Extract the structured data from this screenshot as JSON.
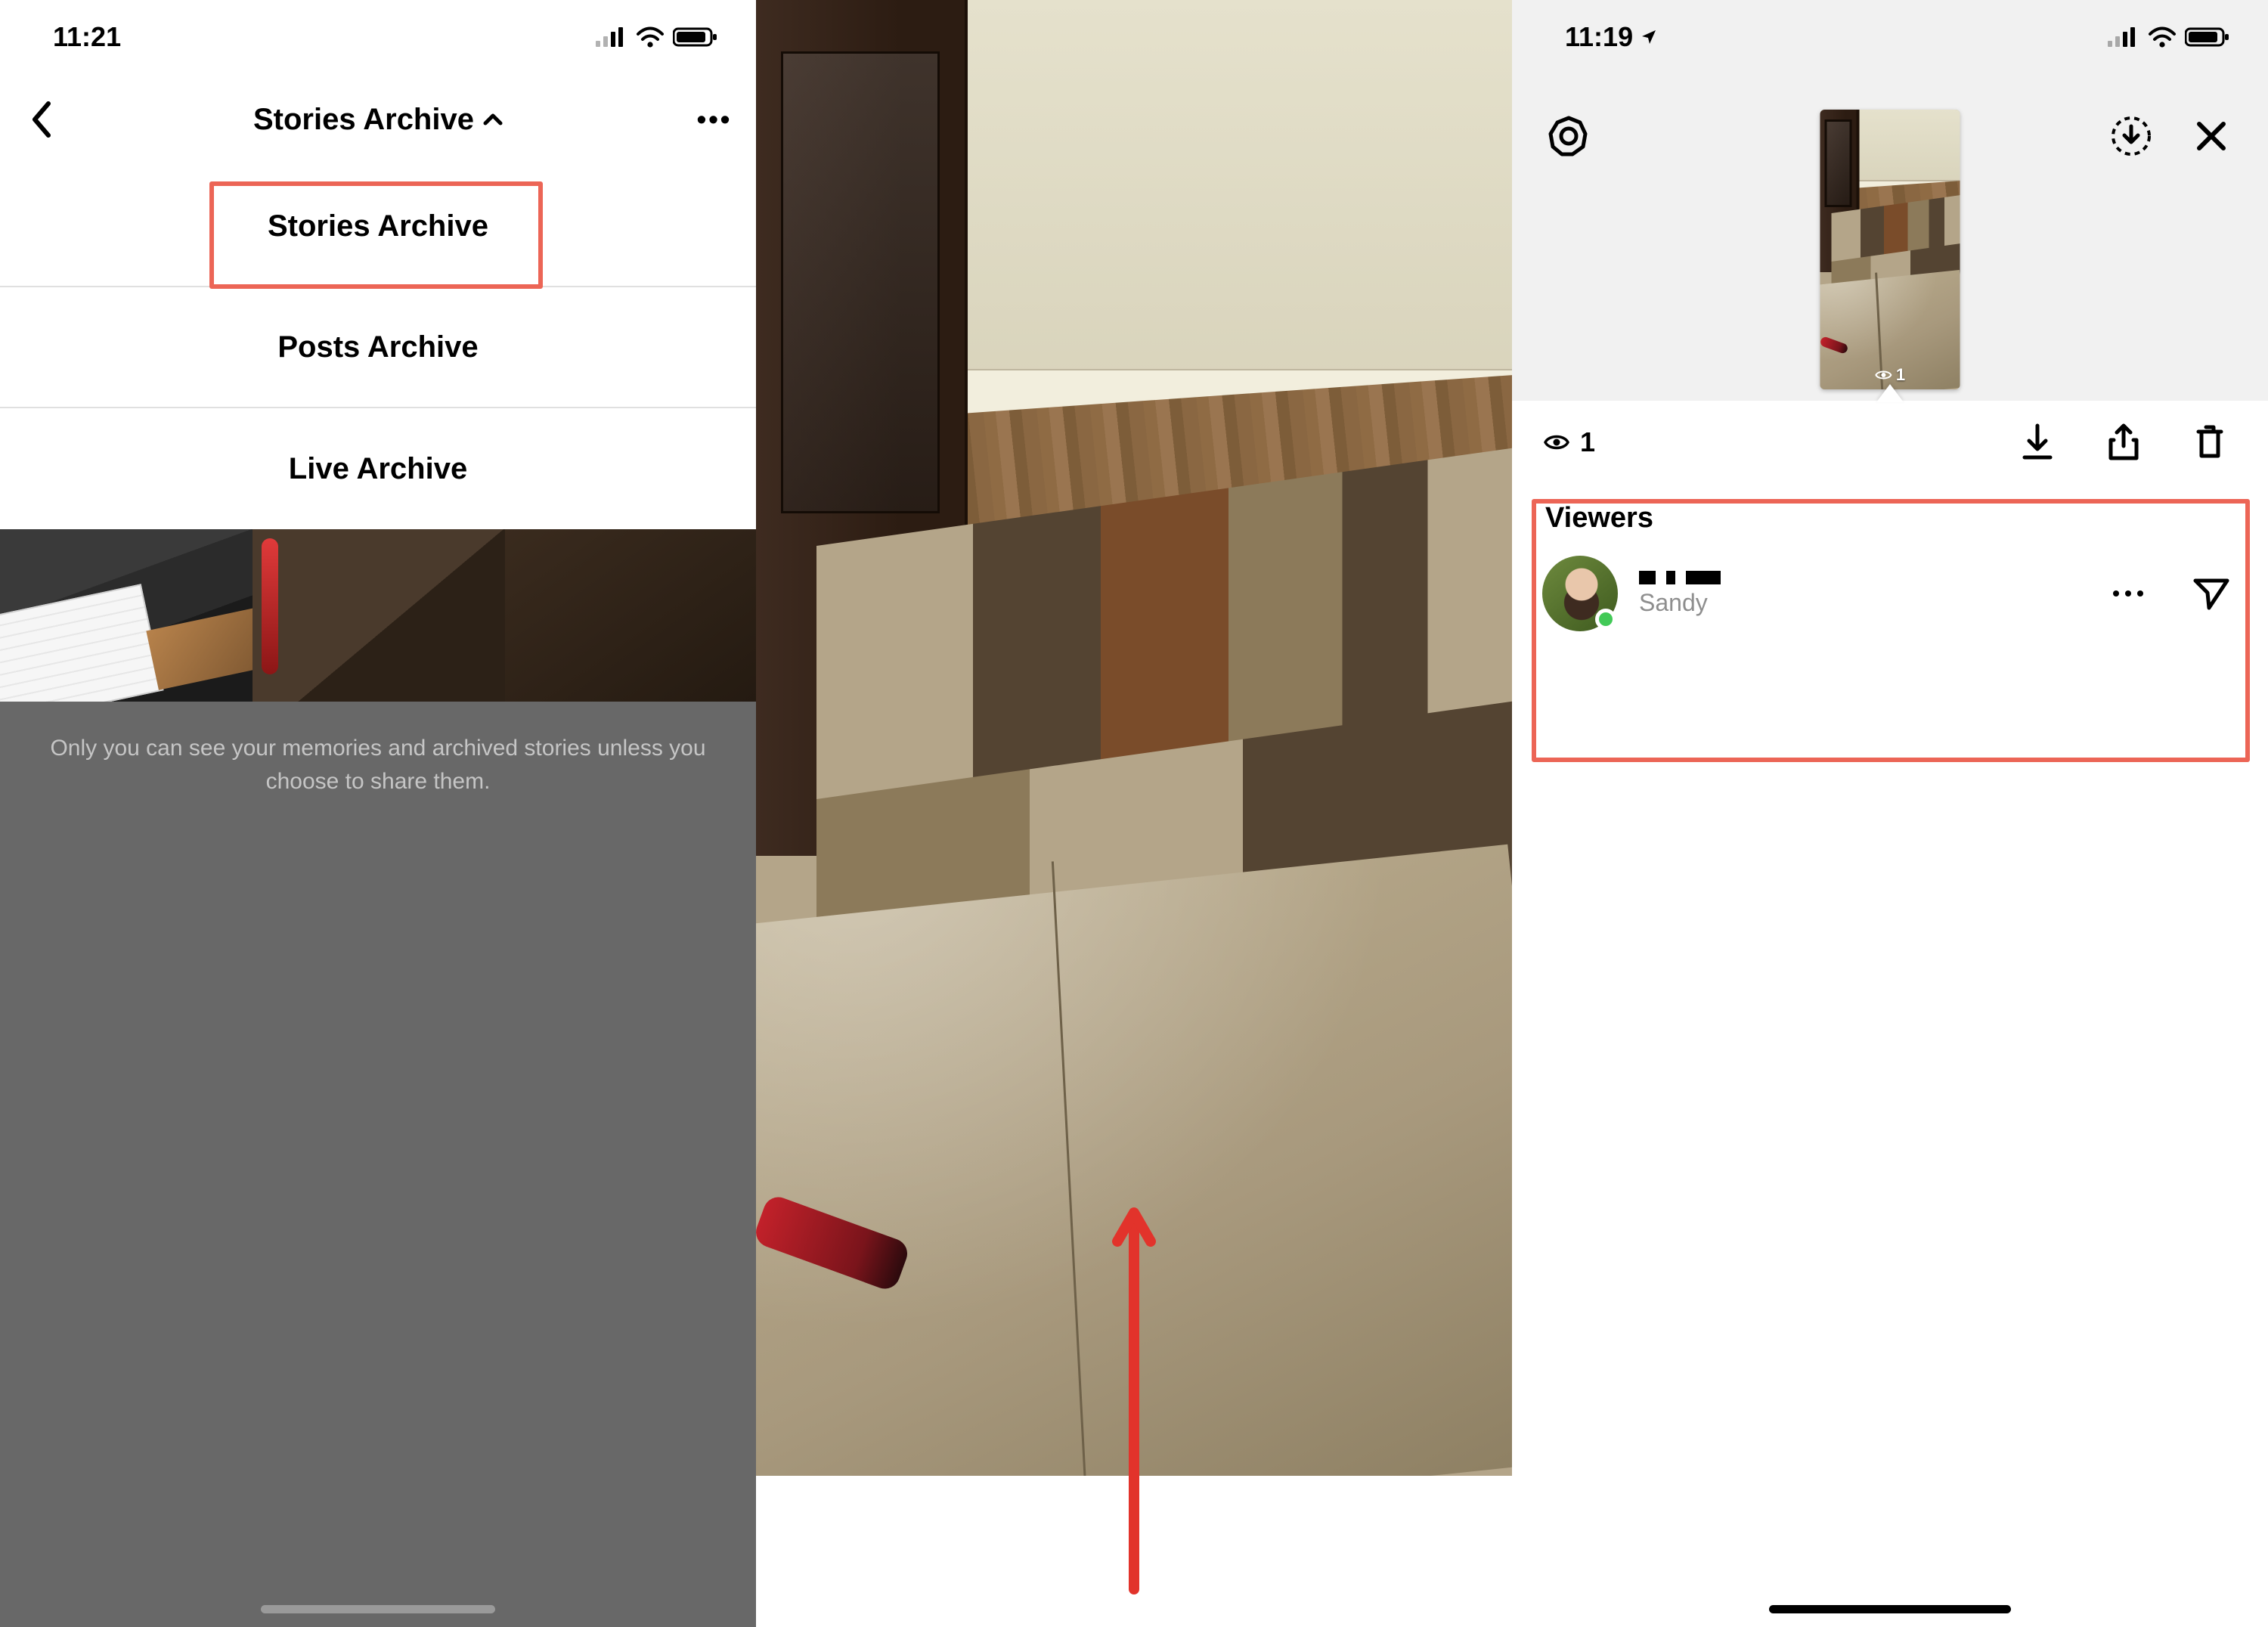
{
  "colors": {
    "highlight": "#ec6556"
  },
  "phone1": {
    "status": {
      "time": "11:21"
    },
    "nav": {
      "title": "Stories Archive",
      "more": "•••"
    },
    "dropdown": {
      "items": [
        {
          "label": "Stories Archive"
        },
        {
          "label": "Posts Archive"
        },
        {
          "label": "Live Archive"
        }
      ]
    },
    "helper_text": "Only you can see your memories and archived stories unless you choose to share them."
  },
  "phone2": {
    "annotation": "swipe-up-arrow"
  },
  "phone3": {
    "status": {
      "time": "11:19"
    },
    "thumb_badge_count": "1",
    "sheet": {
      "view_count": "1",
      "viewers_title": "Viewers",
      "viewers": [
        {
          "display_name": "Sandy"
        }
      ]
    }
  }
}
